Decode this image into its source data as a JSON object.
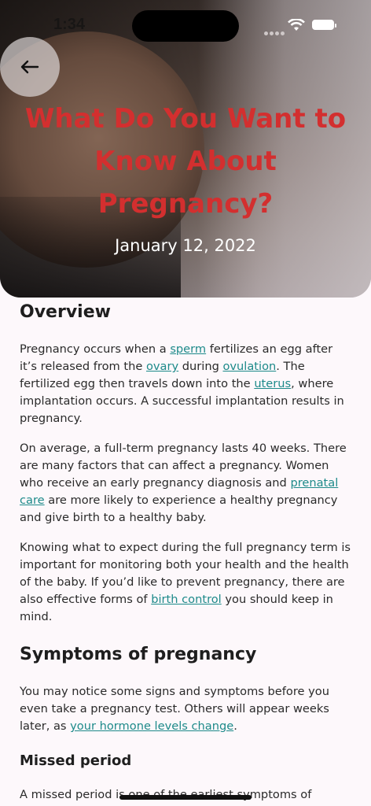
{
  "status": {
    "time": "1:34"
  },
  "header": {
    "title": "What Do You Want to Know About Pregnancy?",
    "date": "January 12, 2022"
  },
  "article": {
    "overview_heading": "Overview",
    "p1": {
      "t1": "Pregnancy occurs when a ",
      "link_sperm": "sperm",
      "t2": " fertilizes an egg after it’s released from the ",
      "link_ovary": "ovary",
      "t3": " during ",
      "link_ovulation": "ovulation",
      "t4": ". The fertilized egg then travels down into the ",
      "link_uterus": "uterus",
      "t5": ", where implantation occurs. A successful implantation results in pregnancy."
    },
    "p2": {
      "t1": "On average, a full-term pregnancy lasts 40 weeks. There are many factors that can affect a pregnancy. Women who receive an early pregnancy diagnosis and ",
      "link_prenatal": "prenatal care",
      "t2": " are more likely to experience a healthy pregnancy and give birth to a healthy baby."
    },
    "p3": {
      "t1": "Knowing what to expect during the full pregnancy term is important for monitoring both your health and the health of the baby. If you’d like to prevent pregnancy, there are also effective forms of ",
      "link_birth_control": "birth control",
      "t2": " you should keep in mind."
    },
    "symptoms_heading": "Symptoms of pregnancy",
    "p4": {
      "t1": "You may notice some signs and symptoms before you even take a pregnancy test. Others will appear weeks later, as ",
      "link_hormone": "your hormone levels change",
      "t2": "."
    },
    "missed_heading": "Missed period",
    "p5": {
      "t1": "A missed period is one of the earliest symptoms of"
    }
  },
  "icons": {
    "back": "arrow-left-icon",
    "wifi": "wifi-icon",
    "battery": "battery-icon",
    "signal": "cellular-signal-icon"
  }
}
